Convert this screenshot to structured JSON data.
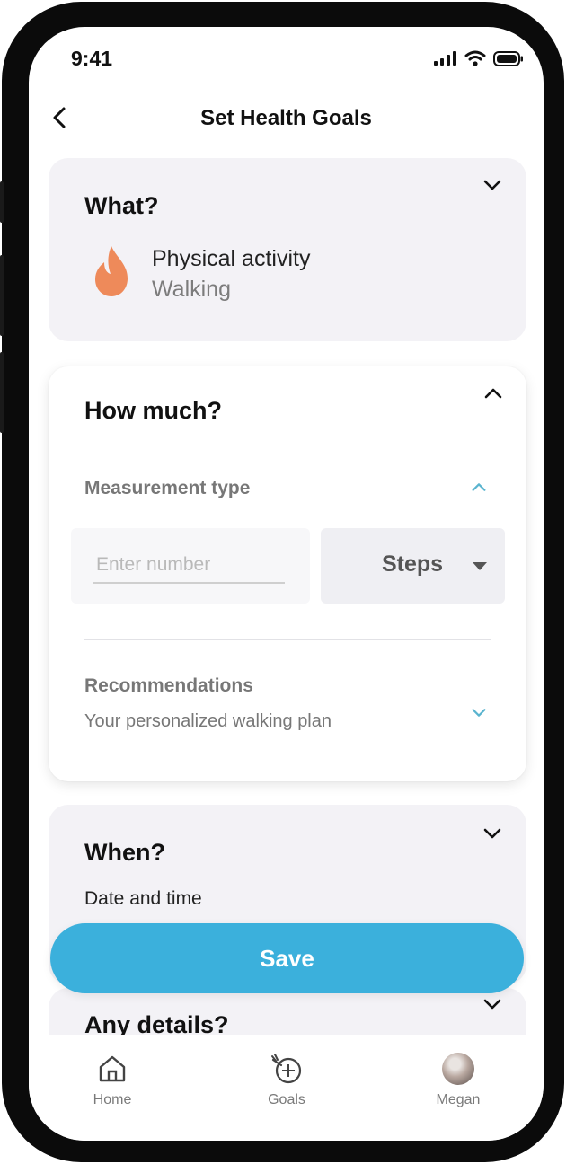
{
  "status_bar": {
    "time": "9:41"
  },
  "header": {
    "title": "Set Health Goals"
  },
  "what": {
    "title": "What?",
    "activity_name": "Physical activity",
    "activity_type": "Walking",
    "icon": "flame-icon",
    "icon_color": "#ee8a5a"
  },
  "how_much": {
    "title": "How much?",
    "measurement_label": "Measurement type",
    "number_placeholder": "Enter number",
    "number_value": "",
    "unit_selected": "Steps",
    "recommendations_label": "Recommendations",
    "recommendations_text": "Your personalized walking plan"
  },
  "when": {
    "title": "When?",
    "subtitle": "Date and time"
  },
  "details": {
    "title": "Any details?"
  },
  "save_label": "Save",
  "tabbar": {
    "items": [
      {
        "label": "Home",
        "icon": "home-icon"
      },
      {
        "label": "Goals",
        "icon": "target-icon"
      },
      {
        "label": "Megan",
        "icon": "avatar"
      }
    ]
  },
  "colors": {
    "accent": "#3bb0dc",
    "chevron_accent": "#5ab4cf",
    "card_gray": "#f3f2f6"
  }
}
